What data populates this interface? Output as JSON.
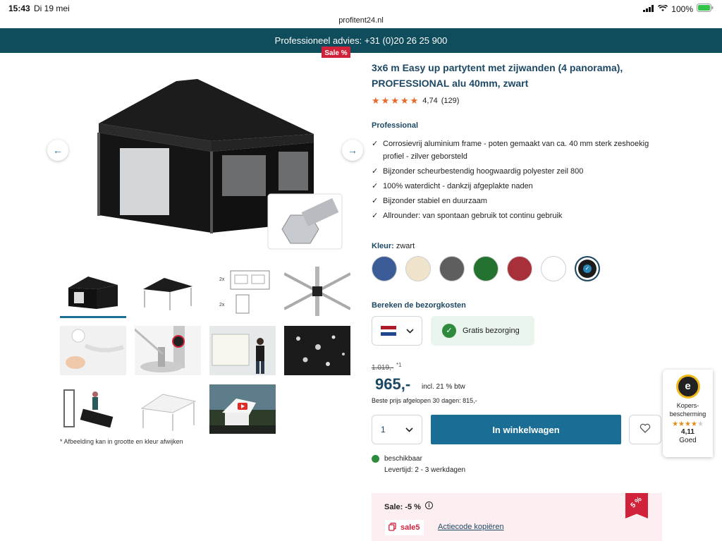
{
  "status_bar": {
    "time": "15:43",
    "date": "Di 19 mei",
    "battery": "100%"
  },
  "browser": {
    "url": "profitent24.nl"
  },
  "topbar": {
    "text": "Professioneel advies: +31 (0)20 26 25 900"
  },
  "gallery": {
    "sale_badge": "Sale %",
    "footnote": "* Afbeelding kan in grootte en kleur afwijken",
    "thumbnails": [
      "tent-front",
      "tent-back",
      "dimension-drawing",
      "frame-detail",
      "wall-detail",
      "foot-plate",
      "mounting-wall",
      "water-drops",
      "carry-bag",
      "white-tent",
      "video"
    ]
  },
  "product": {
    "title": "3x6 m Easy up partytent met zijwanden (4 panorama), PROFESSIONAL alu 40mm, zwart",
    "rating": "4,74",
    "rating_count": "(129)",
    "stars": 5,
    "line_name": "Professional",
    "features": [
      "Corrosievrij aluminium frame - poten gemaakt van ca. 40 mm sterk zeshoekig profiel - zilver geborsteld",
      "Bijzonder scheurbestendig hoogwaardig polyester zeil 800",
      "100% waterdicht - dankzij afgeplakte naden",
      "Bijzonder stabiel en duurzaam",
      "Allrounder: van spontaan gebruik tot continu gebruik"
    ],
    "color_label": "Kleur:",
    "color_value": "zwart",
    "colors": [
      "#3b5c96",
      "#f0e3cc",
      "#5e5e5e",
      "#237230",
      "#a8303a",
      "#ffffff",
      "#1c1c1c"
    ],
    "selected_color_index": 6
  },
  "shipping": {
    "heading": "Bereken de bezorgkosten",
    "free_label": "Gratis bezorging"
  },
  "pricing": {
    "old_price": "1.019,-",
    "old_price_note": "*1",
    "price": "965,-",
    "vat": "incl. 21 % btw",
    "best_price": "Beste prijs afgelopen 30 dagen: 815,-"
  },
  "cart": {
    "quantity": "1",
    "add_label": "In winkelwagen"
  },
  "availability": {
    "status": "beschikbaar",
    "delivery": "Levertijd: 2 - 3 werkdagen"
  },
  "sale": {
    "label": "Sale: -5 %",
    "code": "sale5",
    "copy_label": "Actiecode kopiëren",
    "ribbon": "5 %"
  },
  "trusted_shops": {
    "label": "Kopers-bescherming",
    "score": "4,11",
    "grade": "Goed",
    "stars": 4
  },
  "colors": {
    "brand": "#0f4c5c",
    "accent": "#1a6d94",
    "sale": "#d0223b",
    "star": "#e8682a"
  }
}
